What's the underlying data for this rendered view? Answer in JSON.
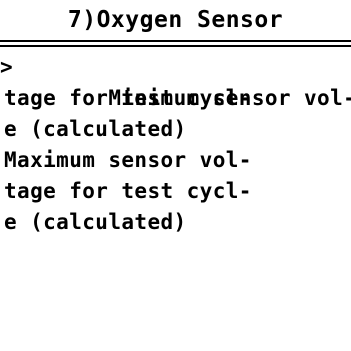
{
  "header": {
    "title": "7)Oxygen Sensor"
  },
  "menu": {
    "cursor_glyph": ">",
    "items": [
      {
        "lines": [
          "Minimum sensor vol-",
          "tage for test cycl-",
          "e (calculated)"
        ],
        "selected": true
      },
      {
        "lines": [
          "Maximum sensor vol-",
          "tage for test cycl-",
          "e (calculated)"
        ],
        "selected": false
      }
    ]
  },
  "colors": {
    "background": "#ffffff",
    "foreground": "#000000"
  }
}
